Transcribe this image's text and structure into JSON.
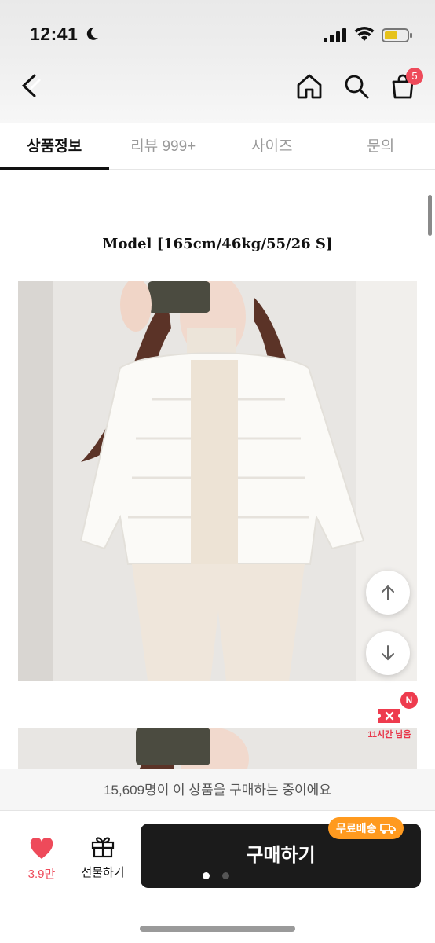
{
  "status_bar": {
    "time": "12:41"
  },
  "header": {
    "cart_count": "5"
  },
  "tabs": [
    {
      "label": "상품정보",
      "active": true
    },
    {
      "label": "리뷰 999+",
      "active": false
    },
    {
      "label": "사이즈",
      "active": false
    },
    {
      "label": "문의",
      "active": false
    }
  ],
  "content": {
    "model_caption": "Model  [165cm/46kg/55/26 S]"
  },
  "timer_badge": {
    "badge": "N",
    "text": "11시간 남음"
  },
  "buyers_notice": "15,609명이 이 상품을 구매하는 중이에요",
  "bottom": {
    "like_count": "3.9만",
    "gift_label": "선물하기",
    "buy_label": "구매하기",
    "free_shipping_label": "무료배송"
  },
  "colors": {
    "accent_red": "#ee4a5a",
    "buy_button": "#1b1b1b",
    "free_shipping": "#ff9a1f"
  },
  "icons": [
    "moon-icon",
    "signal-icon",
    "wifi-icon",
    "battery-icon",
    "back-icon",
    "home-icon",
    "search-icon",
    "cart-icon",
    "arrow-up-icon",
    "arrow-down-icon",
    "ticket-icon",
    "heart-icon",
    "gift-icon",
    "truck-icon"
  ]
}
